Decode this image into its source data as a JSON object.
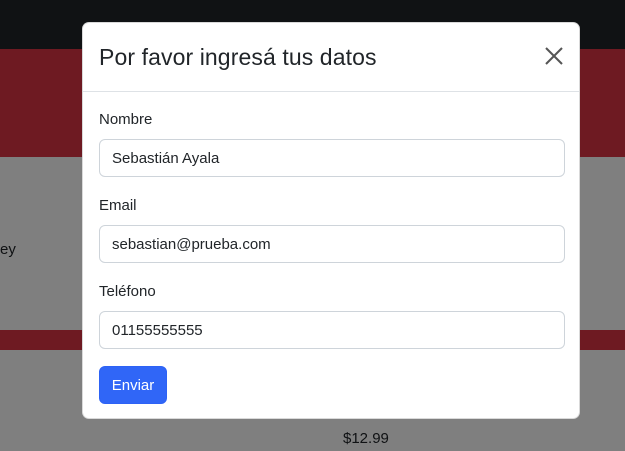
{
  "background": {
    "fragment_text": "ey",
    "price_text": "$12.99"
  },
  "modal": {
    "title": "Por favor ingresá tus datos",
    "close_icon": "close-icon",
    "fields": [
      {
        "label": "Nombre",
        "value": "Sebastián Ayala"
      },
      {
        "label": "Email",
        "value": "sebastian@prueba.com"
      },
      {
        "label": "Teléfono",
        "value": "01155555555"
      }
    ],
    "submit_label": "Enviar"
  },
  "colors": {
    "primary": "#3066f7",
    "hero": "#dc3545",
    "navbar": "#212529"
  }
}
